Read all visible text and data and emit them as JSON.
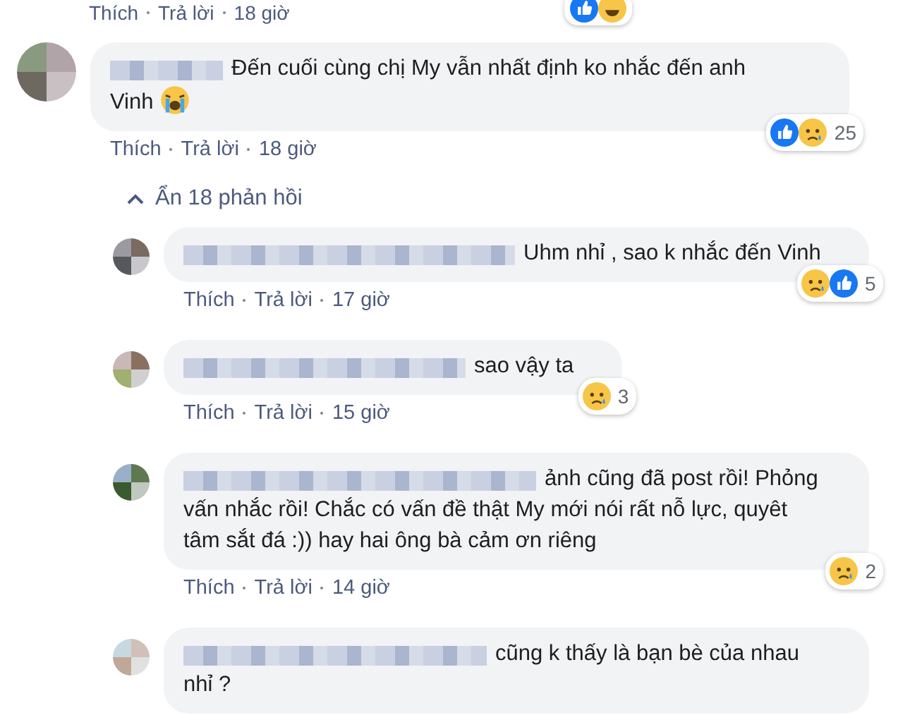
{
  "previous_comment": {
    "actions": [
      "Thích",
      "Trả lời",
      "18 giờ"
    ],
    "reactions": [
      {
        "kind": "like"
      },
      {
        "kind": "haha"
      }
    ]
  },
  "comment": {
    "text": "Đến cuối cùng chị My vẫn nhất định ko nhắc đến anh Vinh",
    "emoji": {
      "kind": "loud-crying"
    },
    "reactions": [
      {
        "kind": "like"
      },
      {
        "kind": "sad"
      }
    ],
    "reaction_count": "25",
    "actions": [
      "Thích",
      "Trả lời",
      "18 giờ"
    ]
  },
  "hide_replies": "Ẩn 18 phản hồi",
  "replies": [
    {
      "text": "Uhm nhỉ , sao k nhắc đến Vinh",
      "reactions": [
        {
          "kind": "sad"
        },
        {
          "kind": "like"
        }
      ],
      "reaction_count": "5",
      "actions": [
        "Thích",
        "Trả lời",
        "17 giờ"
      ]
    },
    {
      "text": "sao vậy ta",
      "reactions": [
        {
          "kind": "sad"
        }
      ],
      "reaction_count": "3",
      "actions": [
        "Thích",
        "Trả lời",
        "15 giờ"
      ]
    },
    {
      "text": "ảnh cũng đã post rồi! Phỏng vấn nhắc rồi! Chắc có vấn đề thật My mới nói rất nỗ lực, quyêt tâm sắt đá :)) hay hai ông bà cảm ơn riêng",
      "reactions": [
        {
          "kind": "sad"
        }
      ],
      "reaction_count": "2",
      "actions": [
        "Thích",
        "Trả lời",
        "14 giờ"
      ]
    },
    {
      "text": "cũng k thấy là bạn bè của nhau nhỉ ?"
    }
  ]
}
